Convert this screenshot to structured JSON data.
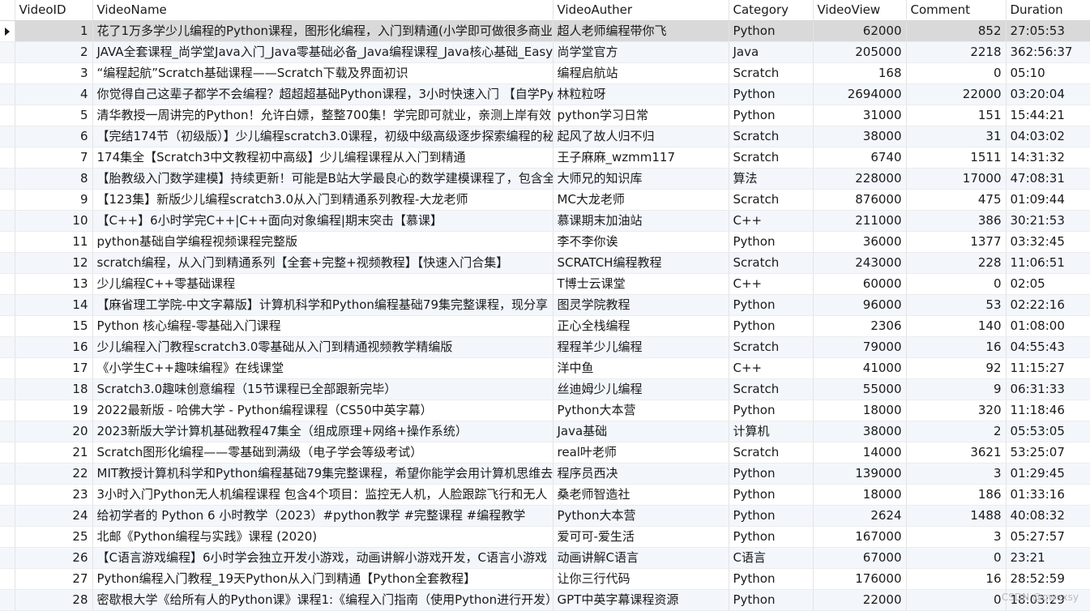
{
  "columns": [
    "VideoID",
    "VideoName",
    "VideoAuther",
    "Category",
    "VideoView",
    "Comment",
    "Duration"
  ],
  "selected_row": 0,
  "watermark": "CSDN @qwexsy",
  "rows": [
    [
      "1",
      "花了1万多学少儿编程的Python课程，图形化编程，入门到精通(小学即可做很多商业",
      "超人老师编程带你飞",
      "Python",
      "62000",
      "852",
      "27:05:53"
    ],
    [
      "2",
      "JAVA全套课程_尚学堂Java入门_Java零基础必备_Java编程课程_Java核心基础_Easy",
      "尚学堂官方",
      "Java",
      "205000",
      "2218",
      "362:56:37"
    ],
    [
      "3",
      "“编程起航”Scratch基础课程——Scratch下载及界面初识",
      "编程启航站",
      "Scratch",
      "168",
      "0",
      "05:10"
    ],
    [
      "4",
      "你觉得自己这辈子都学不会编程？超超超基础Python课程，3小时快速入门 【自学Py",
      "林粒粒呀",
      "Python",
      "2694000",
      "22000",
      "03:20:04"
    ],
    [
      "5",
      "清华教授一周讲完的Python！允许白嫖，整整700集！学完即可就业，亲测上岸有效",
      "python学习日常",
      "Python",
      "31000",
      "151",
      "15:44:21"
    ],
    [
      "6",
      "【完结174节（初级版）】少儿编程scratch3.0课程，初级中级高级逐步探索编程的秘",
      "起风了故人归不归",
      "Scratch",
      "38000",
      "31",
      "04:03:02"
    ],
    [
      "7",
      "174集全【Scratch3中文教程初中高级】少儿编程课程从入门到精通",
      "王子麻麻_wzmm117",
      "Scratch",
      "6740",
      "1511",
      "14:31:32"
    ],
    [
      "8",
      "【胎教级入门数学建模】持续更新！可能是B站大学最良心的数学建模课程了，包含全",
      "大师兄的知识库",
      "算法",
      "228000",
      "17000",
      "47:08:31"
    ],
    [
      "9",
      "【123集】新版少儿编程scratch3.0从入门到精通系列教程-大龙老师",
      "MC大龙老师",
      "Scratch",
      "876000",
      "475",
      "01:09:44"
    ],
    [
      "10",
      "【C++】6小时学完C++|C++面向对象编程|期末突击【慕课】",
      "慕课期末加油站",
      "C++",
      "211000",
      "386",
      "30:21:53"
    ],
    [
      "11",
      "python基础自学编程视频课程完整版",
      "李不李你诶",
      "Python",
      "36000",
      "1377",
      "03:32:45"
    ],
    [
      "12",
      "scratch编程，从入门到精通系列【全套+完整+视频教程】【快速入门合集】",
      "SCRATCH编程教程",
      "Scratch",
      "243000",
      "228",
      "11:06:51"
    ],
    [
      "13",
      "少儿编程C++零基础课程",
      "T博士云课堂",
      "C++",
      "60000",
      "0",
      "02:05"
    ],
    [
      "14",
      "【麻省理工学院-中文字幕版】计算机科学和Python编程基础79集完整课程，现分享",
      "图灵学院教程",
      "Python",
      "96000",
      "53",
      "02:22:16"
    ],
    [
      "15",
      "Python 核心编程-零基础入门课程",
      "正心全栈编程",
      "Python",
      "2306",
      "140",
      "01:08:00"
    ],
    [
      "16",
      "少儿编程入门教程scratch3.0零基础从入门到精通视频教学精编版",
      "程程羊少儿编程",
      "Scratch",
      "79000",
      "16",
      "04:55:43"
    ],
    [
      "17",
      "《小学生C++趣味编程》在线课堂",
      "洋中鱼",
      "C++",
      "41000",
      "92",
      "11:15:27"
    ],
    [
      "18",
      "Scratch3.0趣味创意编程（15节课程已全部跟新完毕）",
      "丝迪姆少儿编程",
      "Scratch",
      "55000",
      "9",
      "06:31:33"
    ],
    [
      "19",
      "2022最新版 - 哈佛大学 - Python编程课程（CS50中英字幕）",
      "Python大本营",
      "Python",
      "18000",
      "320",
      "11:18:46"
    ],
    [
      "20",
      "2023新版大学计算机基础教程47集全（组成原理+网络+操作系统）",
      "Java基础",
      "计算机",
      "38000",
      "2",
      "05:53:05"
    ],
    [
      "21",
      "Scratch图形化编程——零基础到满级（电子学会等级考试）",
      "real叶老师",
      "Scratch",
      "14000",
      "3621",
      "53:25:07"
    ],
    [
      "22",
      "MIT教授计算机科学和Python编程基础79集完整课程，希望你能学会用计算机思维去",
      "程序员西决",
      "Python",
      "139000",
      "3",
      "01:29:45"
    ],
    [
      "23",
      "3小时入门Python无人机编程课程 包含4个项目：监控无人机，人脸跟踪飞行和无人",
      "桑老师智造社",
      "Python",
      "18000",
      "186",
      "01:33:16"
    ],
    [
      "24",
      "给初学者的 Python 6 小时教学（2023）#python教学 #完整课程 #编程教学",
      "Python大本营",
      "Python",
      "2624",
      "1488",
      "40:08:32"
    ],
    [
      "25",
      "北邮《Python编程与实践》课程 (2020)",
      "爱可可-爱生活",
      "Python",
      "167000",
      "3",
      "05:27:57"
    ],
    [
      "26",
      "【C语言游戏编程】6小时学会独立开发小游戏，动画讲解小游戏开发，C语言小游戏",
      "动画讲解C语言",
      "C语言",
      "67000",
      "0",
      "23:21"
    ],
    [
      "27",
      "Python编程入门教程_19天Python从入门到精通【Python全套教程】",
      "让你三行代码",
      "Python",
      "176000",
      "16",
      "28:52:59"
    ],
    [
      "28",
      "密歇根大学《给所有人的Python课》课程1:《编程入门指南（使用Python进行开发）",
      "GPT中英字幕课程资源",
      "Python",
      "22000",
      "0",
      "18:03:29"
    ]
  ]
}
